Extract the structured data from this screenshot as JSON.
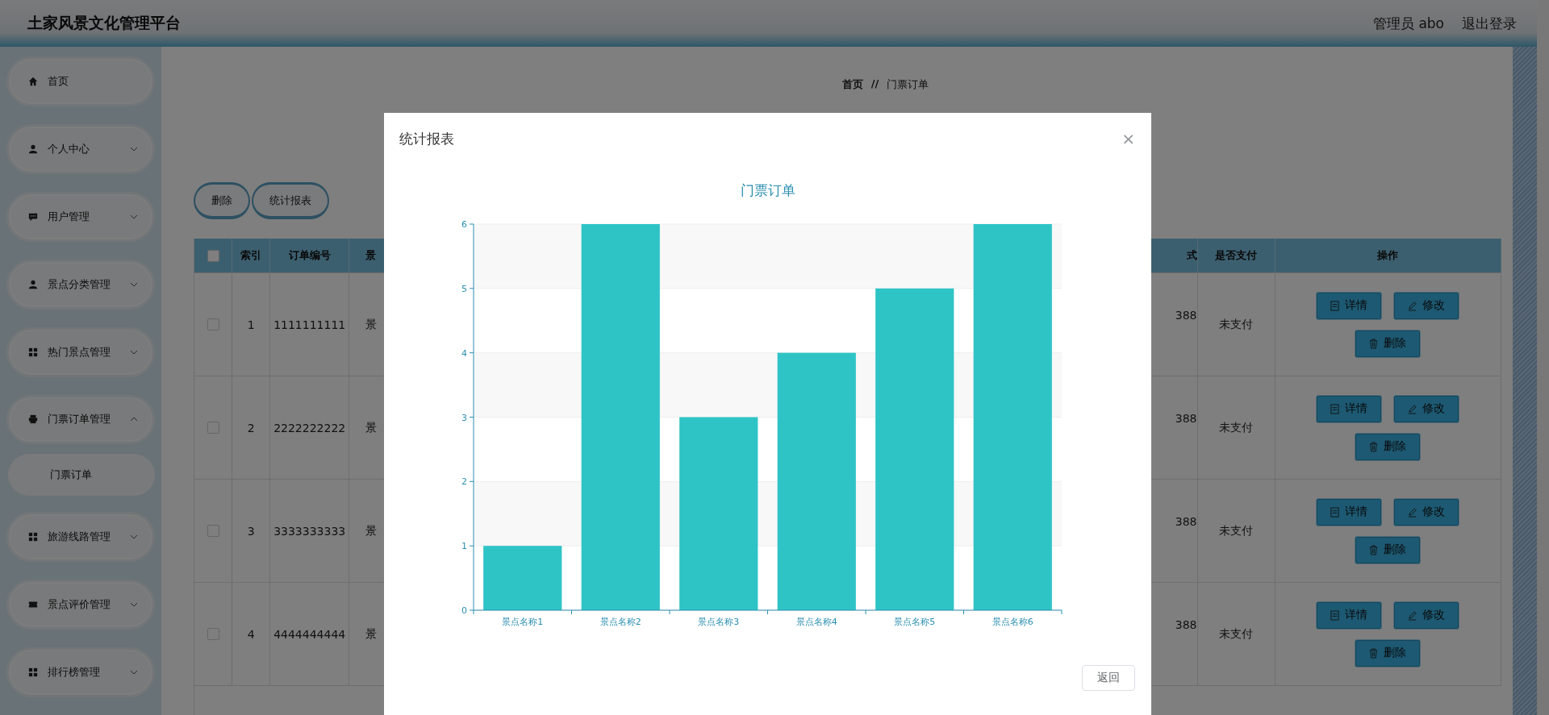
{
  "header": {
    "title": "土家风景文化管理平台",
    "user": "管理员 abo",
    "logout": "退出登录"
  },
  "sidebar": {
    "items": [
      {
        "label": "首页",
        "kind": "link"
      },
      {
        "label": "个人中心",
        "kind": "group",
        "expanded": false
      },
      {
        "label": "用户管理",
        "kind": "group",
        "expanded": false
      },
      {
        "label": "景点分类管理",
        "kind": "group",
        "expanded": false
      },
      {
        "label": "热门景点管理",
        "kind": "group",
        "expanded": false
      },
      {
        "label": "门票订单管理",
        "kind": "group",
        "expanded": true,
        "children": [
          {
            "label": "门票订单"
          }
        ]
      },
      {
        "label": "旅游线路管理",
        "kind": "group",
        "expanded": false
      },
      {
        "label": "景点评价管理",
        "kind": "group",
        "expanded": false
      },
      {
        "label": "排行榜管理",
        "kind": "group",
        "expanded": false
      }
    ]
  },
  "breadcrumb": [
    "首页",
    "门票订单"
  ],
  "breadcrumb_separator": "//",
  "toolbar": [
    "删除",
    "统计报表"
  ],
  "table": {
    "select_all_checked": false,
    "columns": [
      "索引",
      "订单编号",
      "景",
      "式",
      "是否支付",
      "操作"
    ],
    "rows": [
      {
        "checked": false,
        "index": "1",
        "order_no": "1111111111",
        "column_4": "景",
        "column_5": "388",
        "paid": "未支付",
        "actions": [
          {
            "kind": "detail",
            "label": "详情"
          },
          {
            "kind": "edit",
            "label": "修改"
          },
          {
            "kind": "delete",
            "label": "删除"
          }
        ]
      },
      {
        "checked": false,
        "index": "2",
        "order_no": "2222222222",
        "column_4": "景",
        "column_5": "388",
        "paid": "未支付",
        "actions": [
          {
            "kind": "detail",
            "label": "详情"
          },
          {
            "kind": "edit",
            "label": "修改"
          },
          {
            "kind": "delete",
            "label": "删除"
          }
        ]
      },
      {
        "checked": false,
        "index": "3",
        "order_no": "3333333333",
        "column_4": "景",
        "column_5": "388",
        "paid": "未支付",
        "actions": [
          {
            "kind": "detail",
            "label": "详情"
          },
          {
            "kind": "edit",
            "label": "修改"
          },
          {
            "kind": "delete",
            "label": "删除"
          }
        ]
      },
      {
        "checked": false,
        "index": "4",
        "order_no": "4444444444",
        "column_4": "景",
        "column_5": "388",
        "paid": "未支付",
        "actions": [
          {
            "kind": "detail",
            "label": "详情"
          },
          {
            "kind": "edit",
            "label": "修改"
          },
          {
            "kind": "delete",
            "label": "删除"
          }
        ]
      }
    ]
  },
  "dialog": {
    "title": "统计报表",
    "close": "×",
    "back_button": "返回",
    "chart_data": {
      "type": "bar",
      "title": "门票订单",
      "categories": [
        "景点名称1",
        "景点名称2",
        "景点名称3",
        "景点名称4",
        "景点名称5",
        "景点名称6"
      ],
      "values": [
        1,
        6,
        3,
        4,
        5,
        6
      ],
      "ylim": [
        0,
        6
      ],
      "grid": true,
      "yticks": [
        0,
        1,
        2,
        3,
        4,
        5,
        6
      ]
    }
  }
}
